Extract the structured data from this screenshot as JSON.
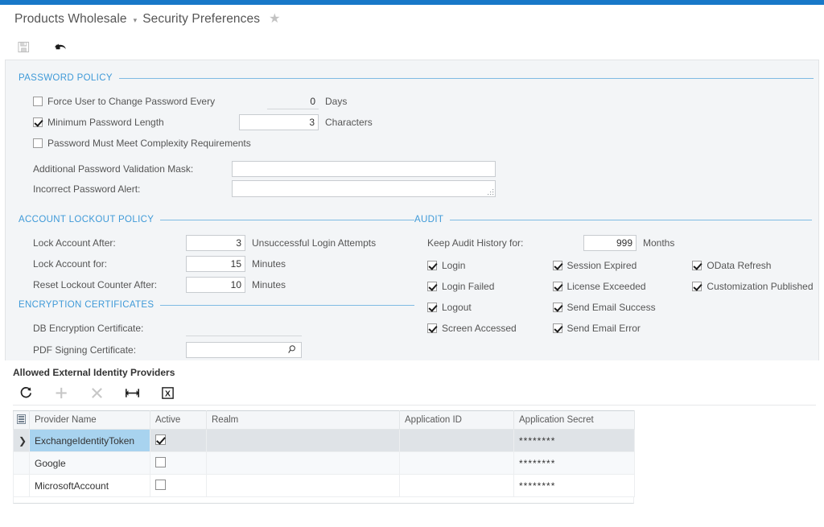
{
  "header": {
    "module": "Products Wholesale",
    "caret": "▾",
    "screen": "Security Preferences",
    "favorite_icon": "star-icon",
    "accent_color": "#1878c8"
  },
  "command_bar": {
    "save_label": "Save",
    "undo_label": "Undo"
  },
  "password_policy": {
    "title": "PASSWORD POLICY",
    "force_change": {
      "label": "Force User to Change Password Every",
      "checked": false,
      "value": "0",
      "unit": "Days"
    },
    "min_length": {
      "label": "Minimum Password Length",
      "checked": true,
      "value": "3",
      "unit": "Characters"
    },
    "complexity": {
      "label": "Password Must Meet Complexity Requirements",
      "checked": false
    },
    "validation_mask": {
      "label": "Additional Password Validation Mask:",
      "value": "",
      "placeholder": ""
    },
    "incorrect_alert": {
      "label": "Incorrect Password Alert:",
      "value": "",
      "placeholder": ""
    }
  },
  "lockout_policy": {
    "title": "ACCOUNT LOCKOUT POLICY",
    "rows": [
      {
        "label": "Lock Account After:",
        "value": "3",
        "unit": "Unsuccessful Login Attempts"
      },
      {
        "label": "Lock Account for:",
        "value": "15",
        "unit": "Minutes"
      },
      {
        "label": "Reset Lockout Counter After:",
        "value": "10",
        "unit": "Minutes"
      }
    ]
  },
  "encryption": {
    "title": "ENCRYPTION CERTIFICATES",
    "db_cert": {
      "label": "DB Encryption Certificate:",
      "value": ""
    },
    "pdf_cert": {
      "label": "PDF Signing Certificate:",
      "value": "",
      "selector_icon": "magnifier-icon"
    }
  },
  "audit": {
    "title": "AUDIT",
    "history": {
      "label": "Keep Audit History for:",
      "value": "999",
      "unit": "Months"
    },
    "columns": [
      [
        {
          "label": "Login",
          "checked": true
        },
        {
          "label": "Login Failed",
          "checked": true
        },
        {
          "label": "Logout",
          "checked": true
        },
        {
          "label": "Screen Accessed",
          "checked": true
        }
      ],
      [
        {
          "label": "Session Expired",
          "checked": true
        },
        {
          "label": "License Exceeded",
          "checked": true
        },
        {
          "label": "Send Email Success",
          "checked": true
        },
        {
          "label": "Send Email Error",
          "checked": true
        }
      ],
      [
        {
          "label": "OData Refresh",
          "checked": true
        },
        {
          "label": "Customization Published",
          "checked": true
        }
      ]
    ]
  },
  "grid": {
    "caption": "Allowed External Identity Providers",
    "toolbar": [
      {
        "name": "refresh-icon",
        "label": "Refresh",
        "enabled": true
      },
      {
        "name": "add-row-icon",
        "label": "Add Row",
        "enabled": false
      },
      {
        "name": "delete-row-icon",
        "label": "Delete Row",
        "enabled": false
      },
      {
        "name": "fit-columns-icon",
        "label": "Fit to Screen",
        "enabled": true
      },
      {
        "name": "export-excel-icon",
        "label": "Export to Excel",
        "enabled": true
      }
    ],
    "columns": [
      "Provider Name",
      "Active",
      "Realm",
      "Application ID",
      "Application Secret"
    ],
    "rows": [
      {
        "selected": true,
        "marker": "❯",
        "provider_name": "ExchangeIdentityToken",
        "active": true,
        "realm": "",
        "application_id": "",
        "application_secret": "********"
      },
      {
        "selected": false,
        "marker": "",
        "provider_name": "Google",
        "active": false,
        "realm": "",
        "application_id": "",
        "application_secret": "********"
      },
      {
        "selected": false,
        "marker": "",
        "provider_name": "MicrosoftAccount",
        "active": false,
        "realm": "",
        "application_id": "",
        "application_secret": "********"
      }
    ]
  }
}
